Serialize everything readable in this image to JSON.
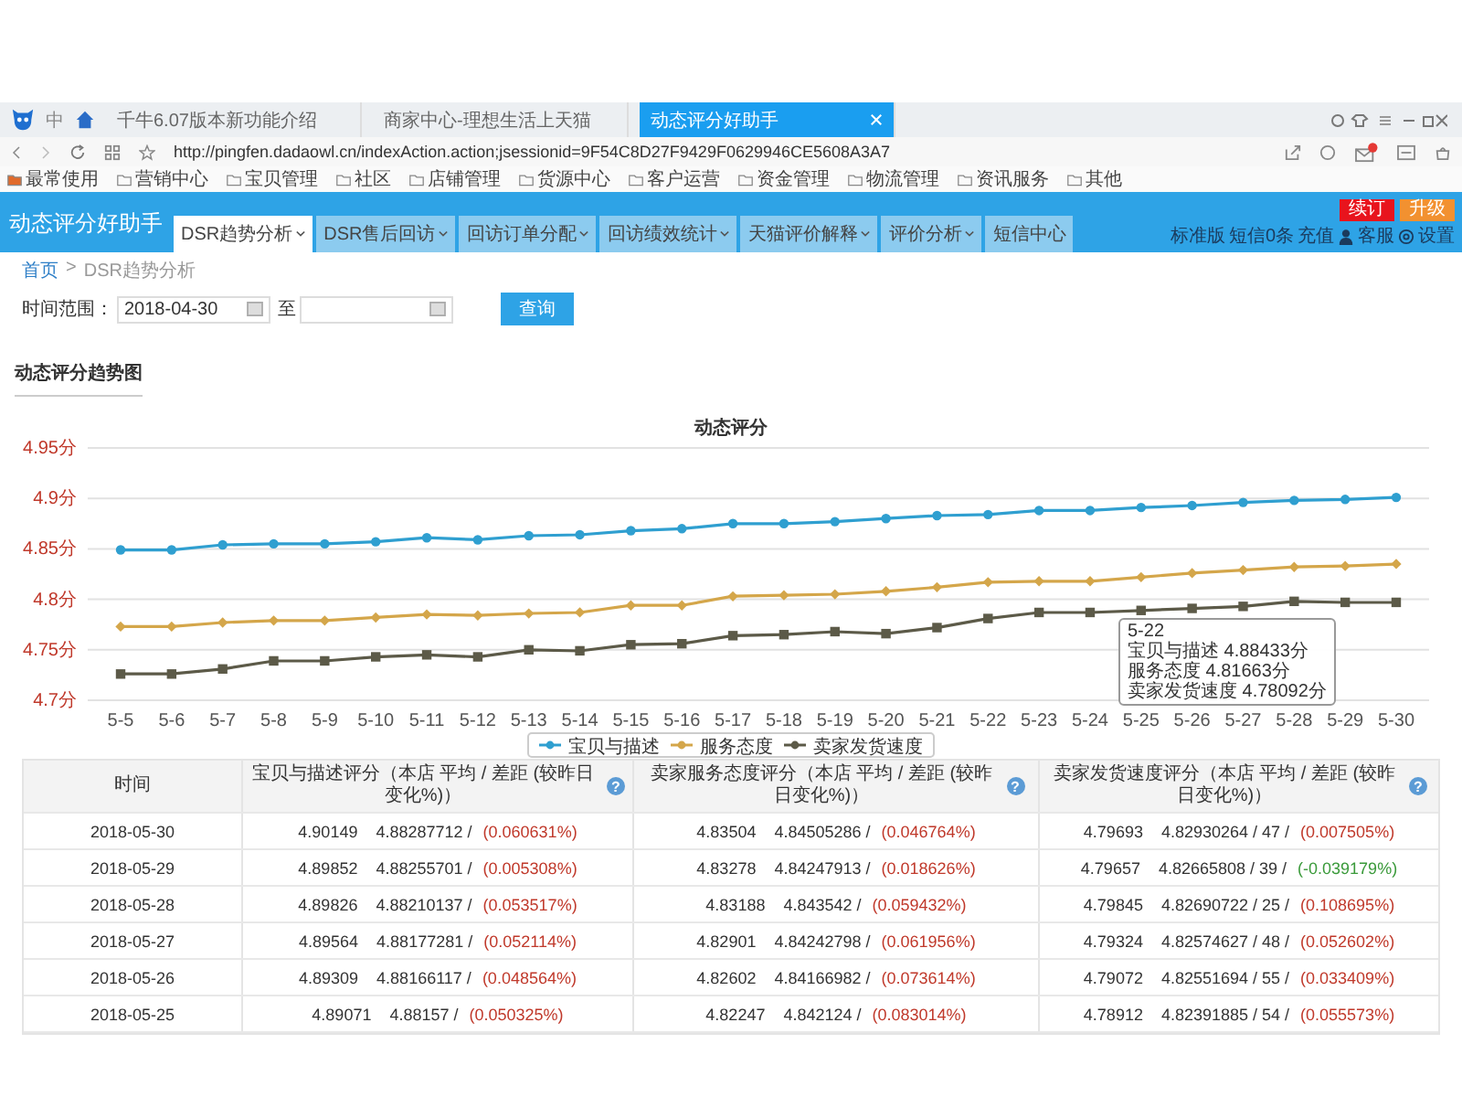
{
  "browser": {
    "lang": "中",
    "tabs": [
      {
        "label": "千牛6.07版本新功能介绍",
        "selected": false
      },
      {
        "label": "商家中心-理想生活上天猫",
        "selected": false
      },
      {
        "label": "动态评分好助手",
        "selected": true
      }
    ],
    "url": "http://pingfen.dadaowl.cn/indexAction.action;jsessionid=9F54C8D27F9429F0629946CE5608A3A7",
    "bookmarks": [
      "最常使用",
      "营销中心",
      "宝贝管理",
      "社区",
      "店铺管理",
      "货源中心",
      "客户运营",
      "资金管理",
      "物流管理",
      "资讯服务",
      "其他"
    ]
  },
  "app": {
    "title": "动态评分好助手",
    "nav": [
      {
        "label": "DSR趋势分析",
        "selected": true,
        "dropdown": true
      },
      {
        "label": "DSR售后回访",
        "selected": false,
        "dropdown": true
      },
      {
        "label": "回访订单分配",
        "selected": false,
        "dropdown": true
      },
      {
        "label": "回访绩效统计",
        "selected": false,
        "dropdown": true
      },
      {
        "label": "天猫评价解释",
        "selected": false,
        "dropdown": true
      },
      {
        "label": "评价分析",
        "selected": false,
        "dropdown": true
      },
      {
        "label": "短信中心",
        "selected": false,
        "dropdown": false
      }
    ],
    "renew": "续订",
    "upgrade": "升级",
    "edition": "标准版",
    "sms": "短信0条",
    "recharge": "充值",
    "service": "客服",
    "settings": "设置"
  },
  "breadcrumb": {
    "home": "首页",
    "separator": ">",
    "current": "DSR趋势分析"
  },
  "filter": {
    "label": "时间范围：",
    "start": "2018-04-30",
    "to": "至",
    "button": "查询"
  },
  "section_title": "动态评分趋势图",
  "chart": {
    "chart_data": {
      "type": "line",
      "title": "动态评分",
      "categories": [
        "5-5",
        "5-6",
        "5-7",
        "5-8",
        "5-9",
        "5-10",
        "5-11",
        "5-12",
        "5-13",
        "5-14",
        "5-15",
        "5-16",
        "5-17",
        "5-18",
        "5-19",
        "5-20",
        "5-21",
        "5-22",
        "5-23",
        "5-24",
        "5-25",
        "5-26",
        "5-27",
        "5-28",
        "5-29",
        "5-30"
      ],
      "ylim": [
        4.7,
        4.95
      ],
      "grid": true,
      "legend": "bottom",
      "yticks": [
        {
          "value": 4.7,
          "label": "4.7分"
        },
        {
          "value": 4.75,
          "label": "4.75分"
        },
        {
          "value": 4.8,
          "label": "4.8分"
        },
        {
          "value": 4.85,
          "label": "4.85分"
        },
        {
          "value": 4.9,
          "label": "4.9分"
        },
        {
          "value": 4.95,
          "label": "4.95分"
        }
      ],
      "series": [
        {
          "name": "宝贝与描述",
          "color": "#2f9fd0",
          "marker": "circle",
          "values": [
            4.849,
            4.849,
            4.854,
            4.855,
            4.855,
            4.857,
            4.861,
            4.859,
            4.863,
            4.864,
            4.868,
            4.87,
            4.875,
            4.875,
            4.877,
            4.88,
            4.883,
            4.884,
            4.888,
            4.888,
            4.891,
            4.893,
            4.896,
            4.898,
            4.899,
            4.901
          ]
        },
        {
          "name": "服务态度",
          "color": "#d4a64a",
          "marker": "diamond",
          "values": [
            4.773,
            4.773,
            4.777,
            4.779,
            4.779,
            4.782,
            4.785,
            4.784,
            4.786,
            4.787,
            4.794,
            4.794,
            4.803,
            4.804,
            4.805,
            4.808,
            4.812,
            4.817,
            4.818,
            4.818,
            4.822,
            4.826,
            4.829,
            4.832,
            4.833,
            4.835
          ]
        },
        {
          "name": "卖家发货速度",
          "color": "#5c5a48",
          "marker": "square",
          "values": [
            4.726,
            4.726,
            4.731,
            4.739,
            4.739,
            4.743,
            4.745,
            4.743,
            4.75,
            4.749,
            4.755,
            4.756,
            4.764,
            4.765,
            4.768,
            4.766,
            4.772,
            4.781,
            4.787,
            4.787,
            4.789,
            4.791,
            4.793,
            4.798,
            4.797,
            4.797
          ]
        }
      ]
    },
    "tooltip": {
      "title": "5-22",
      "lines": [
        "宝贝与描述 4.88433分",
        "服务态度 4.81663分",
        "卖家发货速度 4.78092分"
      ]
    }
  },
  "table": {
    "columns": [
      {
        "label": "时间"
      },
      {
        "label": "宝贝与描述评分（本店 平均 / 差距 (较昨日变化%)）",
        "help": "?"
      },
      {
        "label": "卖家服务态度评分（本店 平均 / 差距 (较昨日变化%)）",
        "help": "?"
      },
      {
        "label": "卖家发货速度评分（本店 平均 / 差距 (较昨日变化%)）",
        "help": "?"
      }
    ],
    "rows": [
      {
        "cells": [
          {
            "kind": "date",
            "text": "2018-05-30"
          },
          {
            "score": "4.90149",
            "average": "4.88287712 /",
            "change": "(0.060631%)",
            "color": "#c0392b"
          },
          {
            "score": "4.83504",
            "average": "4.84505286 /",
            "change": "(0.046764%)",
            "color": "#c0392b"
          },
          {
            "score": "4.79693",
            "average": "4.82930264 / 47 /",
            "change": "(0.007505%)",
            "color": "#c0392b"
          }
        ]
      },
      {
        "cells": [
          {
            "kind": "date",
            "text": "2018-05-29"
          },
          {
            "score": "4.89852",
            "average": "4.88255701 /",
            "change": "(0.005308%)",
            "color": "#c0392b"
          },
          {
            "score": "4.83278",
            "average": "4.84247913 /",
            "change": "(0.018626%)",
            "color": "#c0392b"
          },
          {
            "score": "4.79657",
            "average": "4.82665808 / 39 /",
            "change": "(-0.039179%)",
            "color": "#3a9a3a"
          }
        ]
      },
      {
        "cells": [
          {
            "kind": "date",
            "text": "2018-05-28"
          },
          {
            "score": "4.89826",
            "average": "4.88210137 /",
            "change": "(0.053517%)",
            "color": "#c0392b"
          },
          {
            "score": "4.83188",
            "average": "4.843542 /",
            "change": "(0.059432%)",
            "color": "#c0392b"
          },
          {
            "score": "4.79845",
            "average": "4.82690722 / 25 /",
            "change": "(0.108695%)",
            "color": "#c0392b"
          }
        ]
      },
      {
        "cells": [
          {
            "kind": "date",
            "text": "2018-05-27"
          },
          {
            "score": "4.89564",
            "average": "4.88177281 /",
            "change": "(0.052114%)",
            "color": "#c0392b"
          },
          {
            "score": "4.82901",
            "average": "4.84242798 /",
            "change": "(0.061956%)",
            "color": "#c0392b"
          },
          {
            "score": "4.79324",
            "average": "4.82574627 / 48 /",
            "change": "(0.052602%)",
            "color": "#c0392b"
          }
        ]
      },
      {
        "cells": [
          {
            "kind": "date",
            "text": "2018-05-26"
          },
          {
            "score": "4.89309",
            "average": "4.88166117 /",
            "change": "(0.048564%)",
            "color": "#c0392b"
          },
          {
            "score": "4.82602",
            "average": "4.84166982 /",
            "change": "(0.073614%)",
            "color": "#c0392b"
          },
          {
            "score": "4.79072",
            "average": "4.82551694 / 55 /",
            "change": "(0.033409%)",
            "color": "#c0392b"
          }
        ]
      },
      {
        "cells": [
          {
            "kind": "date",
            "text": "2018-05-25"
          },
          {
            "score": "4.89071",
            "average": "4.88157 /",
            "change": "(0.050325%)",
            "color": "#c0392b"
          },
          {
            "score": "4.82247",
            "average": "4.842124 /",
            "change": "(0.083014%)",
            "color": "#c0392b"
          },
          {
            "score": "4.78912",
            "average": "4.82391885 / 54 /",
            "change": "(0.055573%)",
            "color": "#c0392b"
          }
        ]
      }
    ]
  }
}
